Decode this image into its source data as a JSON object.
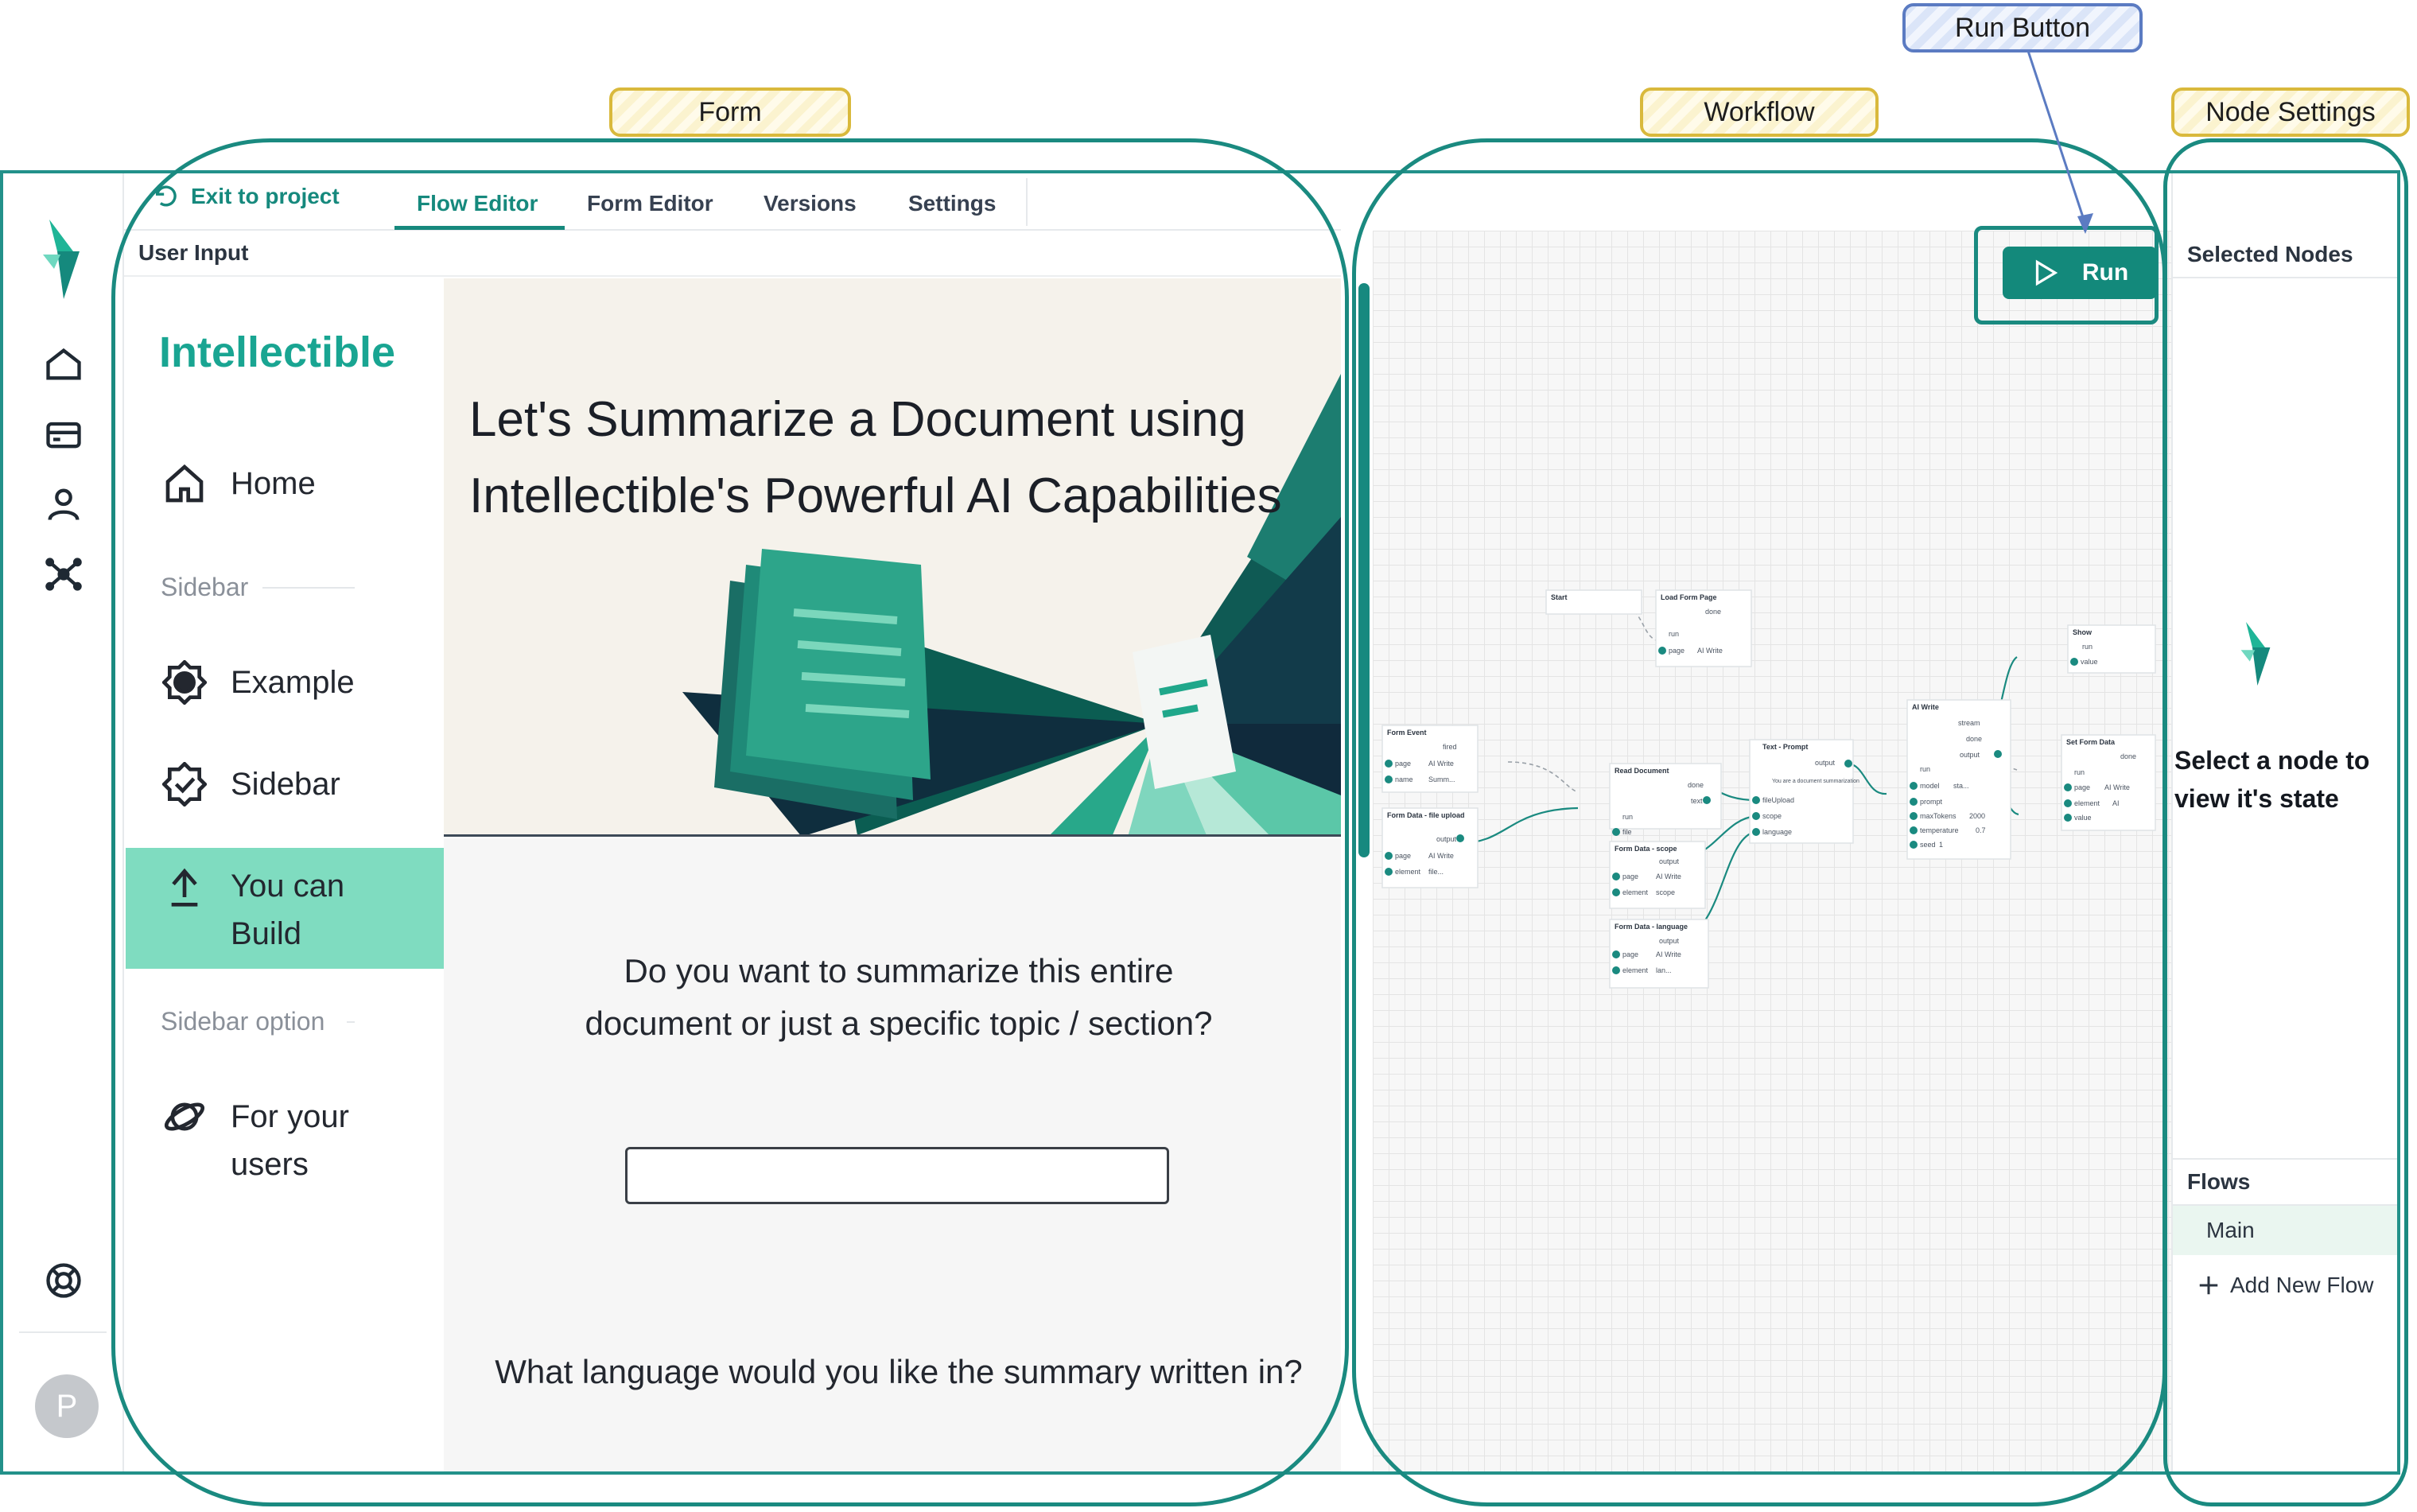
{
  "annotations": {
    "form": "Form",
    "workflow": "Workflow",
    "run_button": "Run Button",
    "node_settings": "Node Settings"
  },
  "header": {
    "exit_label": "Exit to project",
    "tabs": [
      {
        "label": "Flow Editor",
        "active": true
      },
      {
        "label": "Form Editor",
        "active": false
      },
      {
        "label": "Versions",
        "active": false
      },
      {
        "label": "Settings",
        "active": false
      }
    ]
  },
  "preview": {
    "title": "User Input",
    "brand": "Intellectible",
    "sidebar": {
      "home": "Home",
      "section1": "Sidebar",
      "example": "Example",
      "sidebar_item": "Sidebar",
      "build_line1": "You can",
      "build_line2": "Build",
      "section2": "Sidebar option",
      "users_line1": "For your",
      "users_line2": "users"
    },
    "hero_title": "Let's Summarize a Document using Intellectible's Powerful AI Capabilities",
    "question1": "Do you want to summarize this entire document or just a specific topic / section?",
    "answer1": "",
    "question2": "What language would you like the summary written in?"
  },
  "workflow": {
    "run_label": "Run",
    "nodes": {
      "start": {
        "title": "Start"
      },
      "load_form_page": {
        "title": "Load Form Page",
        "out": "done",
        "in": "run",
        "param": "page",
        "value": "AI Write"
      },
      "form_event": {
        "title": "Form Event",
        "out": "fired",
        "p1": "page",
        "v1": "AI Write",
        "p2": "name",
        "v2": "Summ..."
      },
      "form_data_file": {
        "title": "Form Data - file upload",
        "out": "output",
        "p1": "page",
        "v1": "AI Write",
        "p2": "element",
        "v2": "file..."
      },
      "read_document": {
        "title": "Read Document",
        "out1": "done",
        "out2": "text",
        "in1": "run",
        "in2": "file"
      },
      "form_data_scope": {
        "title": "Form Data - scope",
        "out": "output",
        "p1": "page",
        "v1": "AI Write",
        "p2": "element",
        "v2": "scope"
      },
      "form_data_language": {
        "title": "Form Data - language",
        "out": "output",
        "p1": "page",
        "v1": "AI Write",
        "p2": "element",
        "v2": "lan..."
      },
      "text_prompt": {
        "title": "Text - Prompt",
        "out": "output",
        "body": "You are a document summarization",
        "in1": "fileUpload",
        "in2": "scope",
        "in3": "language"
      },
      "ai_write": {
        "title": "AI Write",
        "out1": "stream",
        "out2": "done",
        "out3": "output",
        "in1": "run",
        "in2": "model",
        "v2": "sta...",
        "in3": "prompt",
        "in4": "maxTokens",
        "v4": "2000",
        "in5": "temperature",
        "v5": "0.7",
        "in6": "seed",
        "v6": "1"
      },
      "show": {
        "title": "Show",
        "in1": "run",
        "in2": "value"
      },
      "set_form_data": {
        "title": "Set Form Data",
        "out": "done",
        "in1": "run",
        "in2": "page",
        "v2": "AI Write",
        "in3": "element",
        "v3": "AI",
        "in4": "value"
      }
    }
  },
  "right_panel": {
    "selected_nodes": "Selected Nodes",
    "select_message": "Select a node to view it's state",
    "flows": "Flows",
    "main_flow": "Main",
    "add_flow": "Add New Flow"
  },
  "user": {
    "avatar_initial": "P"
  },
  "colors": {
    "accent": "#16897d",
    "brand": "#19a592",
    "active_bg": "#7fdcc0",
    "region_outline": "#1a8a80"
  }
}
